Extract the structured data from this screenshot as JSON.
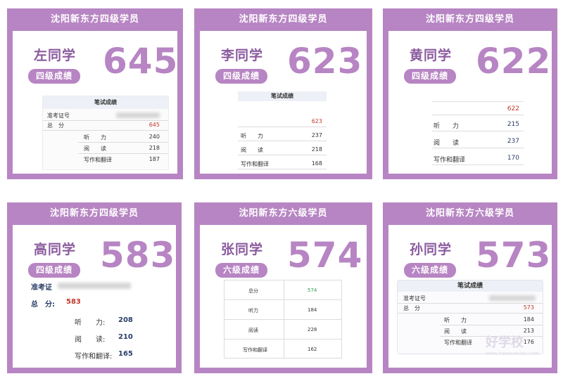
{
  "cards": [
    {
      "title": "沈阳新东方四级学员",
      "name": "左同学",
      "level": "四级成绩",
      "score": "645",
      "transcript": {
        "header": "笔试成绩",
        "id_label": "准考证号",
        "total_label": "总　分",
        "total": "645",
        "rows": [
          {
            "label": "听　　力",
            "value": "240"
          },
          {
            "label": "阅　　读",
            "value": "218"
          },
          {
            "label": "写作和翻译",
            "value": "187"
          }
        ]
      }
    },
    {
      "title": "沈阳新东方四级学员",
      "name": "李同学",
      "level": "四级成绩",
      "score": "623",
      "transcript": {
        "header": "笔试成绩",
        "total": "623",
        "rows": [
          {
            "label": "听　　力",
            "value": "237"
          },
          {
            "label": "阅　　读",
            "value": "218"
          },
          {
            "label": "写作和翻译",
            "value": "168"
          }
        ]
      }
    },
    {
      "title": "沈阳新东方四级学员",
      "name": "黄同学",
      "level": "四级成绩",
      "score": "622",
      "transcript": {
        "total": "622",
        "rows": [
          {
            "label": "听　　力",
            "value": "215"
          },
          {
            "label": "阅　　读",
            "value": "237"
          },
          {
            "label": "写作和翻译",
            "value": "170"
          }
        ]
      }
    },
    {
      "title": "沈阳新东方四级学员",
      "name": "高同学",
      "level": "四级成绩",
      "score": "583",
      "transcript": {
        "id_label": "准考证",
        "total_label": "总　分:",
        "total": "583",
        "rows": [
          {
            "label": "听　　力:",
            "value": "208"
          },
          {
            "label": "阅　　读:",
            "value": "210"
          },
          {
            "label": "写作和翻译:",
            "value": "165"
          }
        ]
      }
    },
    {
      "title": "沈阳新东方六级学员",
      "name": "张同学",
      "level": "六级成绩",
      "score": "574",
      "transcript": {
        "total_label": "总分",
        "total": "574",
        "rows": [
          {
            "label": "听力",
            "value": "184"
          },
          {
            "label": "阅读",
            "value": "228"
          },
          {
            "label": "写作和翻译",
            "value": "162"
          }
        ]
      }
    },
    {
      "title": "沈阳新东方六级学员",
      "name": "孙同学",
      "level": "六级成绩",
      "score": "573",
      "transcript": {
        "header": "笔试成绩",
        "id_label": "准考证号",
        "total_label": "总　分",
        "total": "573",
        "rows": [
          {
            "label": "听　　力",
            "value": "184"
          },
          {
            "label": "阅　　读",
            "value": "213"
          },
          {
            "label": "写作和翻译",
            "value": "176"
          }
        ]
      }
    }
  ],
  "watermark": {
    "text": "好学校",
    "sub": "www.haoxuexiao.com"
  },
  "colors": {
    "accent": "#b785c3",
    "name": "#8a5a9e",
    "red": "#c0392b",
    "green": "#2e9e55",
    "navy": "#2a3e66"
  }
}
